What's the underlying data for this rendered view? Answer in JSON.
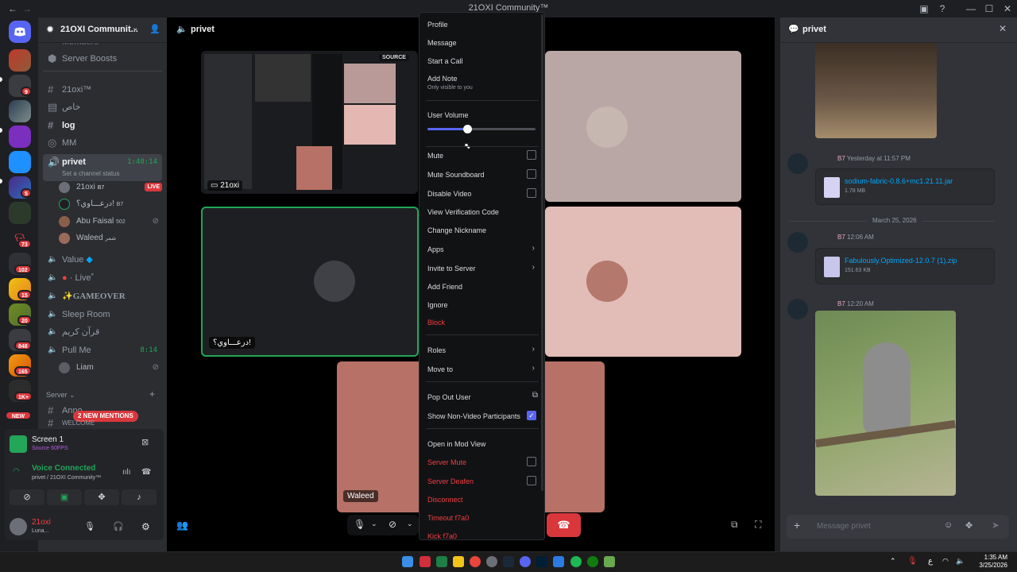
{
  "titlebar": {
    "title": "21OXI Community™"
  },
  "server_header": {
    "name": "21OXI Communit..."
  },
  "server_badges": [
    "9",
    "5",
    "73",
    "102",
    "15",
    "20",
    "848",
    "165",
    "1K+"
  ],
  "server_new": "NEW",
  "channels": {
    "top_partial": "Members",
    "boosts": "Server Boosts",
    "items": [
      {
        "name": "21oxi™"
      },
      {
        "name": "خاص"
      },
      {
        "name": "log"
      },
      {
        "name": "MM"
      }
    ],
    "active_voice": {
      "name": "privet",
      "timer": "1:40:14",
      "status": "Set a channel status"
    },
    "voice_users": [
      {
        "name": "21oxi",
        "tag": "B7",
        "live": "LIVE"
      },
      {
        "name": "درعـــاوي؟!",
        "tag": "B7"
      },
      {
        "name": "Abu Faisal",
        "tag": "502"
      },
      {
        "name": "Waleed",
        "tag": "شمر"
      }
    ],
    "voice_channels": [
      {
        "name": "Value"
      },
      {
        "name": "· Live˚"
      },
      {
        "name": "GAMEOVER"
      },
      {
        "name": "Sleep Room"
      },
      {
        "name": "قرآن كريم"
      },
      {
        "name": "Pull Me",
        "timer": "8:14"
      }
    ],
    "pullme_user": "Liam",
    "category": "Server",
    "mentions": "2 NEW MENTIONS",
    "partial_channel": "Anno...",
    "partial_channel2": "WELCOME"
  },
  "screen_panel": {
    "title": "Screen 1",
    "sub": "Source 60FPS"
  },
  "voice_panel": {
    "status": "Voice Connected",
    "location": "privet / 21OXI Community™"
  },
  "user_panel": {
    "name": "21oxi",
    "status": "Luna..."
  },
  "stage": {
    "channel": "privet",
    "source_label": "SOURCE",
    "stream_owner": "21oxi",
    "tile_name_arabic": "درعـــاوي؟!",
    "tile_name_waleed": "Waleed"
  },
  "context_menu": {
    "profile": "Profile",
    "message": "Message",
    "start_call": "Start a Call",
    "add_note": "Add Note",
    "add_note_sub": "Only visible to you",
    "user_volume": "User Volume",
    "user_volume_fraction": 0.37,
    "mute": "Mute",
    "mute_soundboard": "Mute Soundboard",
    "disable_video": "Disable Video",
    "view_verification": "View Verification Code",
    "change_nickname": "Change Nickname",
    "apps": "Apps",
    "invite": "Invite to Server",
    "add_friend": "Add Friend",
    "ignore": "Ignore",
    "block": "Block",
    "roles": "Roles",
    "move_to": "Move to",
    "pop_out": "Pop Out User",
    "show_nonvideo": "Show Non-Video Participants",
    "open_mod": "Open in Mod View",
    "server_mute": "Server Mute",
    "server_deafen": "Server Deafen",
    "disconnect": "Disconnect",
    "timeout": "Timeout f7a0",
    "kick": "Kick f7a0"
  },
  "thread": {
    "title": "privet",
    "msg1": {
      "tag": "B7",
      "time": "Yesterday at 11:57 PM",
      "file": "sodium-fabric-0.8.6+mc1.21.11.jar",
      "size": "1.78 MB"
    },
    "date_divider": "March 25, 2026",
    "msg2": {
      "tag": "B7",
      "time": "12:06 AM",
      "file": "Fabulously.Optimized-12.0.7 (1).zip",
      "size": "151.63 KB"
    },
    "msg3": {
      "tag": "B7",
      "time": "12:20 AM"
    },
    "composer_placeholder": "Message privet"
  },
  "taskbar": {
    "lang": "ع",
    "time": "1:35 AM",
    "date": "3/25/2026"
  },
  "colors": {
    "accent": "#5865f2",
    "danger": "#da373c",
    "green": "#23a55a",
    "bg": "#1e1f22"
  }
}
